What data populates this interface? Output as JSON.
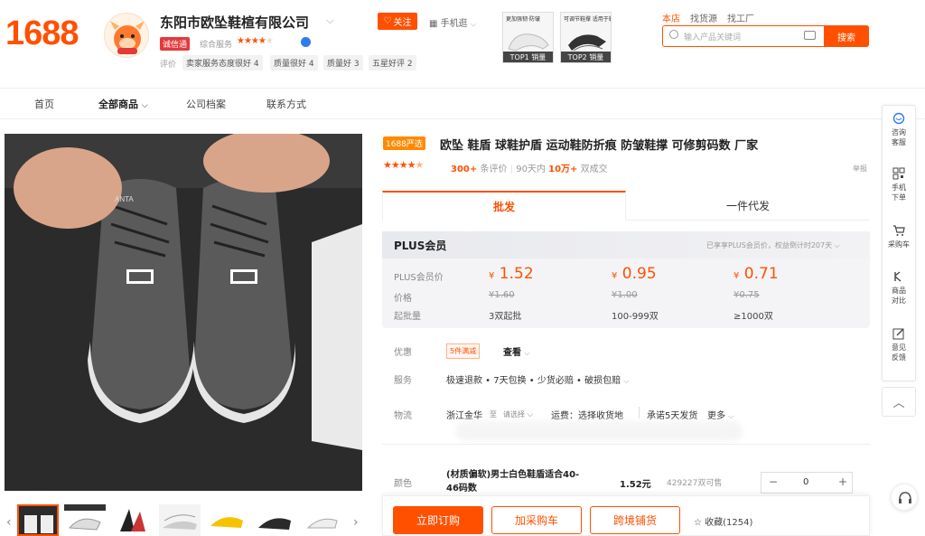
{
  "header": {
    "logo": "1688",
    "shop_name": "东阳市欧坠鞋楦有限公司",
    "shop_badge": "诚信通",
    "composite_label": "综合服务",
    "rating_label": "评价",
    "rating_tags": [
      "卖家服务态度很好 4",
      "质量很好 4",
      "质量好 3",
      "五星好评 2"
    ],
    "follow_label": "关注",
    "mobile_shop_label": "手机逛",
    "top_products": [
      {
        "caption": "更加强韧·防皱",
        "rank": "TOP1 销量"
      },
      {
        "caption": "可调节鞋撑 适用于鞋子",
        "rank": "TOP2 销量"
      }
    ]
  },
  "search": {
    "tabs": [
      "本店",
      "找货源",
      "找工厂"
    ],
    "active_tab": "本店",
    "placeholder": "输入产品关键词",
    "button_label": "搜索"
  },
  "nav": {
    "items": [
      "首页",
      "全部商品",
      "公司档案",
      "联系方式"
    ],
    "active": "全部商品"
  },
  "gallery": {
    "shoe_brand_text": "ANTA",
    "thumb_count": 7
  },
  "product": {
    "tag": "1688严选",
    "title": "欧坠 鞋盾 球鞋护盾 运动鞋防折痕 防皱鞋撑 可修剪码数 厂家",
    "rating": "4.5",
    "reviews_count": "300+",
    "reviews_label": "条评价",
    "sales_prefix": "90天内",
    "sales_count": "10万+",
    "sales_label": "双成交",
    "report_label": "举报"
  },
  "tabs": {
    "wholesale": "批发",
    "dropship": "一件代发"
  },
  "plus": {
    "title": "PLUS会员",
    "hint": "已享享PLUS会员价，权益倒计时207天",
    "member_price_label": "PLUS会员价",
    "price_label": "价格",
    "moq_label": "起批量",
    "tiers": [
      {
        "member_price": "1.52",
        "price": "¥1.60",
        "moq": "3双起批"
      },
      {
        "member_price": "0.95",
        "price": "¥1.00",
        "moq": "100-999双"
      },
      {
        "member_price": "0.71",
        "price": "¥0.75",
        "moq": "≥1000双"
      }
    ]
  },
  "details": {
    "promo_label": "优惠",
    "promo_tag": "5件满减",
    "promo_more": "查看",
    "service_label": "服务",
    "service_text": "极速退款 • 7天包换 • 少货必赔 • 破损包赔",
    "logistics_label": "物流",
    "from": "浙江金华",
    "to": "至",
    "to_select": "请选择",
    "freight": "运费：选择收货地",
    "ship": "承诺5天发货",
    "more": "更多"
  },
  "sku": {
    "color_label": "颜色",
    "name": "(材质偏软)男士白色鞋盾适合40-46码数",
    "price": "1.52元",
    "stock": "429227双可售",
    "qty": "0"
  },
  "actions": {
    "buy": "立即订购",
    "cart": "加采购车",
    "cross": "跨境铺货",
    "fav": "收藏(1254)"
  },
  "sidebar": {
    "items": [
      {
        "label": "咨询客服",
        "icon": "headset-icon"
      },
      {
        "label": "手机下单",
        "icon": "qrcode-icon"
      },
      {
        "label": "采购车",
        "icon": "cart-icon"
      },
      {
        "label": "商品对比",
        "icon": "compare-icon"
      },
      {
        "label": "意见反馈",
        "icon": "feedback-icon"
      }
    ]
  },
  "colors": {
    "brand": "#ff5000",
    "tag_orange": "#ff8a00",
    "verify_blue": "#2f7bea"
  }
}
